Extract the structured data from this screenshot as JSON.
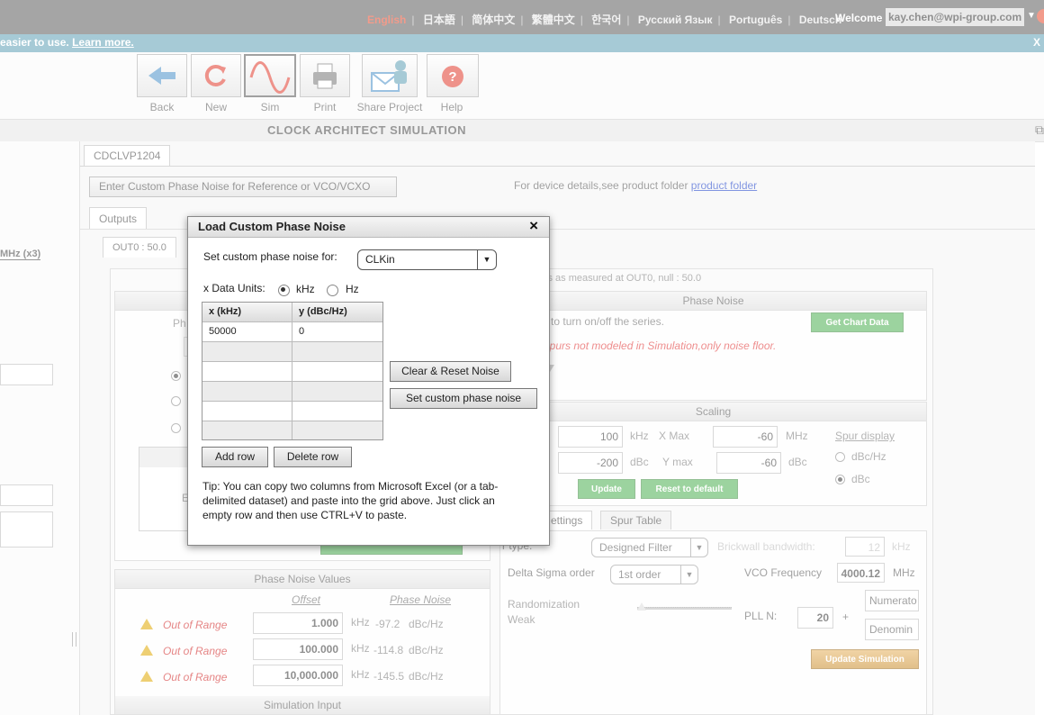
{
  "header": {
    "languages": [
      "English",
      "日本語",
      "简体中文",
      "繁體中文",
      "한국어",
      "Русский Язык",
      "Português",
      "Deutsch"
    ],
    "welcome_label": "Welcome",
    "user_email": "kay.chen@wpi-group.com"
  },
  "notice": {
    "text": "easier to use.",
    "link": "Learn more.",
    "close": "X"
  },
  "toolbar": {
    "back": "Back",
    "new": "New",
    "sim": "Sim",
    "print": "Print",
    "share": "Share Project",
    "help": "Help"
  },
  "section_title": "CLOCK ARCHITECT SIMULATION",
  "left": {
    "freq_label": "MHz (x3)"
  },
  "main": {
    "device_tab": "CDCLVP1204",
    "custom_noise_button": "Enter Custom Phase Noise for Reference or VCO/VCXO",
    "device_details_text": "For device details,see product folder",
    "product_folder_link": "product folder",
    "outputs_tab": "Outputs",
    "out0_tab": "OUT0 : 50.0",
    "chart_caption": "cs as measured at OUT0, null : 50.0",
    "phase_noise_header": "Phase Noise",
    "legend_hint": "he legend to turn on/off the series.",
    "get_chart_data": "Get Chart Data",
    "spur_warning": "l Divider Spurs not modeled in Simulation,only noise floor.",
    "partial_ph": "Ph",
    "partial_e": "E",
    "scaling": {
      "header": "Scaling",
      "xmin": "100",
      "xmin_unit": "kHz",
      "xmax_label": "X Max",
      "xmax": "-60",
      "xmax_unit": "MHz",
      "ymin": "-200",
      "ymin_unit": "dBc",
      "ymax_label": "Y max",
      "ymax": "-60",
      "ymax_unit": "dBc",
      "spur_display": "Spur display",
      "opt_dbchz": "dBc/Hz",
      "opt_dbc": "dBc",
      "update": "Update",
      "reset": "Reset to default"
    },
    "settings": {
      "tab_settings": "ettings",
      "tab_spur": "Spur Table",
      "filter_type_label": "r type:",
      "filter_type": "Designed Filter",
      "brickwall_label": "Brickwall bandwidth:",
      "brickwall": "12",
      "brickwall_unit": "kHz",
      "ds_order_label": "Delta Sigma order",
      "ds_order": "1st order",
      "vco_freq_label": "VCO Frequency",
      "vco_freq": "4000.12",
      "vco_unit": "MHz",
      "random_label": "Randomization",
      "weak_label": "Weak",
      "numerator": "Numerato",
      "plln_label": "PLL N:",
      "plln": "20",
      "plus": "+",
      "denominator": "Denomin",
      "update_sim": "Update Simulation"
    },
    "pn_values": {
      "header": "Phase Noise Values",
      "offset_header": "Offset",
      "pn_header": "Phase Noise",
      "rows": [
        {
          "status": "Out of Range",
          "offset": "1.000",
          "offset_unit": "kHz",
          "pn": "-97.2",
          "pn_unit": "dBc/Hz"
        },
        {
          "status": "Out of Range",
          "offset": "100.000",
          "offset_unit": "kHz",
          "pn": "-114.8",
          "pn_unit": "dBc/Hz"
        },
        {
          "status": "Out of Range",
          "offset": "10,000.000",
          "offset_unit": "kHz",
          "pn": "-145.5",
          "pn_unit": "dBc/Hz"
        }
      ]
    },
    "sim_input_header": "Simulation Input"
  },
  "dialog": {
    "title": "Load Custom Phase Noise",
    "close": "×",
    "set_for_label": "Set custom phase noise for:",
    "set_for_value": "CLKin",
    "units_label": "x Data Units:",
    "unit_khz": "kHz",
    "unit_hz": "Hz",
    "col_x": "x (kHz)",
    "col_y": "y (dBc/Hz)",
    "rows": [
      {
        "x": "50000",
        "y": "0"
      }
    ],
    "clear_reset": "Clear & Reset Noise",
    "set_custom": "Set custom phase noise",
    "add_row": "Add row",
    "delete_row": "Delete row",
    "tip": "Tip: You can copy two columns from Microsoft Excel (or a tab-delimited dataset) and paste into the grid above. Just click an empty row and then use CTRL+V to paste."
  }
}
